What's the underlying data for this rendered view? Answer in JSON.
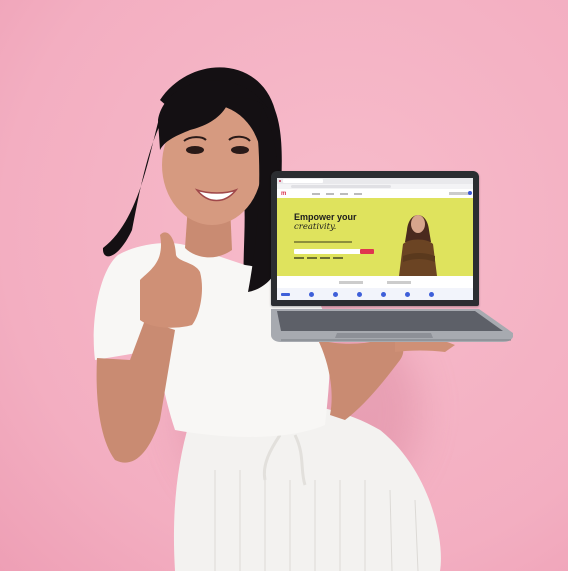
{
  "scene": {
    "background_color": "#f4b2c4",
    "subject": "woman-with-laptop-thumbs-up"
  },
  "laptop_screen": {
    "logo": "m",
    "hero_title": "Empower your",
    "hero_subtitle": "creativity.",
    "hero_color": "#dfe35d",
    "accent_color": "#e0354f",
    "link_color": "#3e5fd9"
  }
}
